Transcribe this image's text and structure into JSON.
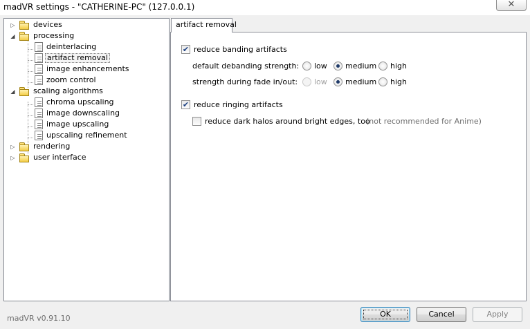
{
  "window": {
    "title": "madVR settings - \"CATHERINE-PC\" (127.0.0.1)",
    "close_glyph": "✕"
  },
  "tree": {
    "items": [
      {
        "label": "devices",
        "icon": "folder-icon",
        "expanded": false
      },
      {
        "label": "processing",
        "icon": "folder-icon",
        "expanded": true
      },
      {
        "label": "deinterlacing",
        "icon": "page-icon"
      },
      {
        "label": "artifact removal",
        "icon": "page-icon",
        "selected": true
      },
      {
        "label": "image enhancements",
        "icon": "page-icon"
      },
      {
        "label": "zoom control",
        "icon": "page-icon"
      },
      {
        "label": "scaling algorithms",
        "icon": "folder-icon",
        "expanded": true
      },
      {
        "label": "chroma upscaling",
        "icon": "page-icon"
      },
      {
        "label": "image downscaling",
        "icon": "page-icon"
      },
      {
        "label": "image upscaling",
        "icon": "page-icon"
      },
      {
        "label": "upscaling refinement",
        "icon": "page-icon"
      },
      {
        "label": "rendering",
        "icon": "folder-icon",
        "expanded": false
      },
      {
        "label": "user interface",
        "icon": "folder-icon",
        "expanded": false
      }
    ],
    "expanded_glyph": "◢",
    "collapsed_glyph": "▷"
  },
  "tab": {
    "label": "artifact removal"
  },
  "settings": {
    "reduce_banding": {
      "label": "reduce banding artifacts",
      "checked": true
    },
    "default_strength": {
      "label": "default debanding strength:",
      "options": [
        "low",
        "medium",
        "high"
      ],
      "selected": "medium"
    },
    "fade_strength": {
      "label": "strength during fade in/out:",
      "options": [
        "low",
        "medium",
        "high"
      ],
      "selected": "medium",
      "disabled_option": "low"
    },
    "reduce_ringing": {
      "label": "reduce ringing artifacts",
      "checked": true
    },
    "dark_halos": {
      "label": "reduce dark halos around bright edges, too",
      "checked": false,
      "note": "(not recommended for Anime)"
    },
    "check_glyph": "✔"
  },
  "footer": {
    "version": "madVR v0.91.10",
    "ok_label": "OK",
    "cancel_label": "Cancel",
    "apply_label": "Apply"
  }
}
